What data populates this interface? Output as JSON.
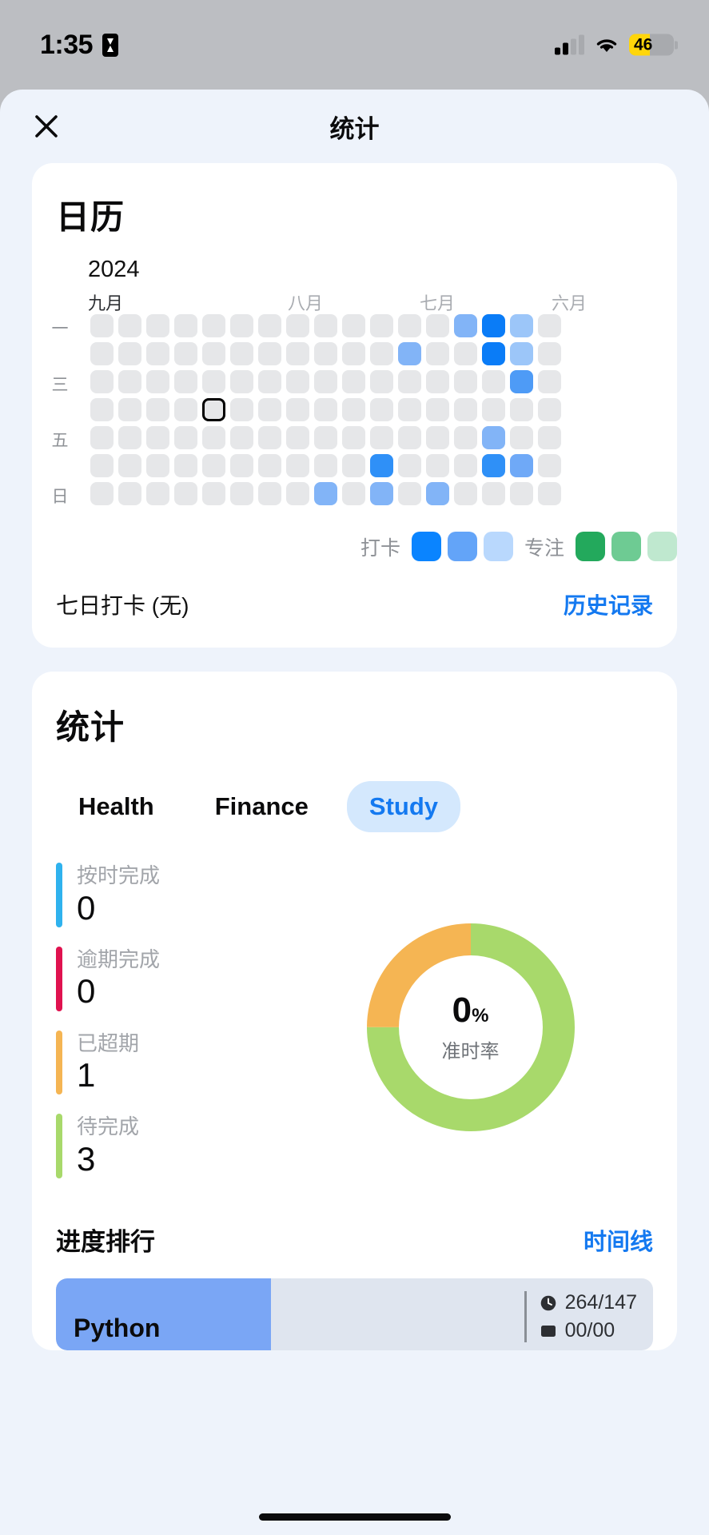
{
  "status_bar": {
    "time": "1:35",
    "timer_icon": "hourglass-icon",
    "signal_icon": "cellular-signal-icon",
    "wifi_icon": "wifi-icon",
    "battery_level": "46",
    "battery_fill_pct": 46,
    "battery_low_power_color": "#ffd60a"
  },
  "nav": {
    "title": "统计",
    "close_icon": "close-icon"
  },
  "calendar": {
    "title": "日历",
    "year": "2024",
    "months": [
      "九月",
      "八月",
      "七月",
      "六月"
    ],
    "current_month": "九月",
    "weekdays": [
      "一",
      "",
      "三",
      "",
      "五",
      "",
      "日"
    ],
    "legend": {
      "checkin_label": "打卡",
      "checkin_colors": [
        "#0a84ff",
        "#63a4f8",
        "#b9d8fd"
      ],
      "focus_label": "专注",
      "focus_colors": [
        "#23a95c",
        "#6ecb93",
        "#bfe8cf"
      ]
    },
    "empty_cell_color": "#e6e7e9",
    "footer_text": "七日打卡 (无)",
    "footer_link": "历史记录",
    "today_cell": {
      "row": 3,
      "col": 4
    },
    "colored_cells": [
      {
        "row": 0,
        "col": 13,
        "color": "#82b4f7"
      },
      {
        "row": 0,
        "col": 14,
        "color": "#0a7cf7"
      },
      {
        "row": 0,
        "col": 15,
        "color": "#9cc6f9"
      },
      {
        "row": 1,
        "col": 11,
        "color": "#82b4f7"
      },
      {
        "row": 1,
        "col": 14,
        "color": "#0a7cf7"
      },
      {
        "row": 1,
        "col": 15,
        "color": "#9cc6f9"
      },
      {
        "row": 2,
        "col": 15,
        "color": "#4e9bf6"
      },
      {
        "row": 4,
        "col": 14,
        "color": "#82b4f7"
      },
      {
        "row": 5,
        "col": 10,
        "color": "#2f90f7"
      },
      {
        "row": 5,
        "col": 14,
        "color": "#2f90f7"
      },
      {
        "row": 5,
        "col": 15,
        "color": "#6fa9f7"
      },
      {
        "row": 6,
        "col": 8,
        "color": "#82b4f7"
      },
      {
        "row": 6,
        "col": 10,
        "color": "#82b4f7"
      },
      {
        "row": 6,
        "col": 12,
        "color": "#82b4f7"
      }
    ]
  },
  "stats": {
    "title": "统计",
    "tabs": [
      {
        "label": "Health",
        "active": false
      },
      {
        "label": "Finance",
        "active": false
      },
      {
        "label": "Study",
        "active": true
      }
    ],
    "metrics": [
      {
        "label": "按时完成",
        "value": "0",
        "color": "#2fb2ee"
      },
      {
        "label": "逾期完成",
        "value": "0",
        "color": "#e0124f"
      },
      {
        "label": "已超期",
        "value": "1",
        "color": "#f5b košt"
      },
      {
        "label": "待完成",
        "value": "3",
        "color": "#a8d96b"
      }
    ],
    "ranking": {
      "title": "进度排行",
      "link": "时间线",
      "rows": [
        {
          "name": "Python",
          "progress_pct": 36,
          "fill_color": "#7aa6f5",
          "track_color": "#dfe5ef",
          "time_icon": "clock-icon",
          "time_value": "264/147",
          "task_icon": "checklist-icon",
          "task_value": "00/00"
        }
      ]
    }
  },
  "chart_data": {
    "type": "pie",
    "title": "准时率",
    "center_label": "0",
    "center_unit": "%",
    "center_sub": "准时率",
    "categories": [
      "待完成",
      "已超期"
    ],
    "values": [
      75,
      25
    ],
    "colors": [
      "#a8d96b",
      "#f5b553"
    ],
    "legend": "none",
    "donut_inner_ratio": 0.62
  }
}
